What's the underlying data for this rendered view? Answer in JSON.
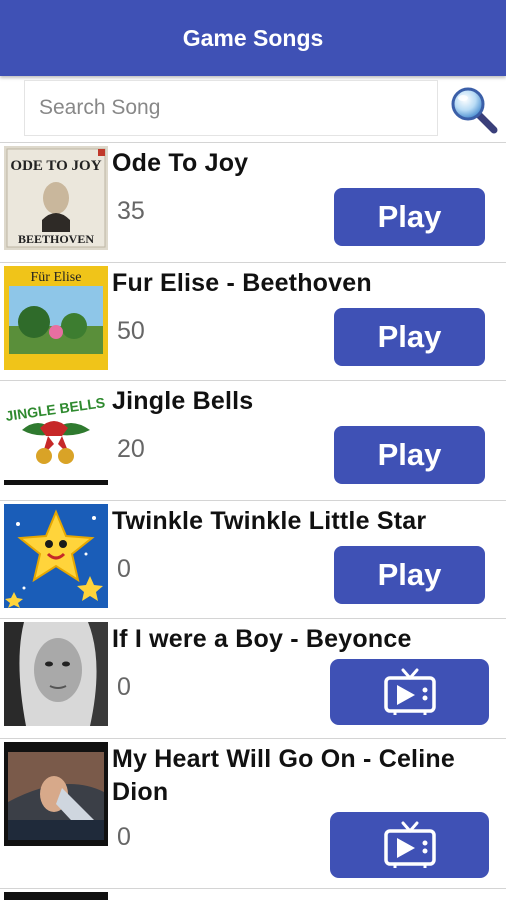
{
  "app": {
    "title": "Game Songs"
  },
  "search": {
    "placeholder": "Search Song",
    "value": ""
  },
  "songs": [
    {
      "title": "Ode To Joy",
      "count": "35",
      "action": "Play",
      "art_text_top": "ODE TO JOY",
      "art_text_bottom": "BEETHOVEN"
    },
    {
      "title": "Fur Elise - Beethoven",
      "count": "50",
      "action": "Play",
      "art_text_top": "Für Elise"
    },
    {
      "title": "Jingle Bells",
      "count": "20",
      "action": "Play",
      "art_text_top": "JINGLE BELLS"
    },
    {
      "title": "Twinkle Twinkle Little Star",
      "count": "0",
      "action": "Play"
    },
    {
      "title": "If I were a Boy - Beyonce",
      "count": "0",
      "action_icon": "tv-play-icon"
    },
    {
      "title": "My Heart Will Go On - Celine Dion",
      "count": "0",
      "action_icon": "tv-play-icon"
    }
  ],
  "colors": {
    "primary": "#3f51b5",
    "divider": "#d4d4d4"
  }
}
